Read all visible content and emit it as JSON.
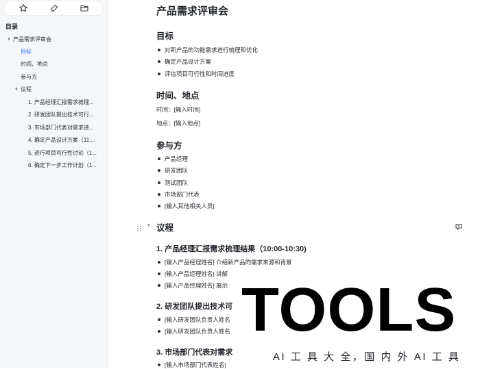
{
  "sidebar": {
    "toolbar": {
      "icons": [
        "star-icon",
        "tag-icon",
        "folder-icon"
      ]
    },
    "toc_title": "目录",
    "items": [
      {
        "label": "产品需求评审会",
        "level": 0,
        "caret": "▼"
      },
      {
        "label": "目标",
        "level": 1,
        "active": true
      },
      {
        "label": "时间、地点",
        "level": 1
      },
      {
        "label": "参与方",
        "level": 1
      },
      {
        "label": "议程",
        "level": 1,
        "caret": "▼"
      },
      {
        "label": "1. 产品经理汇报需求梳理...",
        "level": 2
      },
      {
        "label": "2. 研发团队提出技术可行...",
        "level": 2
      },
      {
        "label": "3. 市场部门代表对需求进...",
        "level": 2
      },
      {
        "label": "4. 确定产品设计方案（11:...",
        "level": 2
      },
      {
        "label": "5. 进行项目可行性讨论（1...",
        "level": 2
      },
      {
        "label": "6. 确定下一步工作计划（1...",
        "level": 2
      }
    ]
  },
  "doc": {
    "title": "产品需求评审会",
    "goal": {
      "heading": "目标",
      "items": [
        "对新产品的功能需求进行梳理和优化",
        "确定产品设计方案",
        "评估项目可行性和时间进度"
      ]
    },
    "time_place": {
      "heading": "时间、地点",
      "time": "时间：[输入时间]",
      "place": "地点：[输入地点]"
    },
    "participants": {
      "heading": "参与方",
      "items": [
        "产品经理",
        "研发团队",
        "测试团队",
        "市场部门代表",
        "[输入其他相关人员]"
      ]
    },
    "agenda": {
      "heading": "议程",
      "sections": [
        {
          "heading": "1. 产品经理汇报需求梳理结果（10:00-10:30)",
          "items": [
            "[输入产品经理姓名] 介绍新产品的需求来源和背景",
            "[输入产品经理姓名] 讲解",
            "[输入产品经理姓名] 展示"
          ]
        },
        {
          "heading": "2. 研发团队提出技术可",
          "items": [
            "[输入研发团队负责人姓名",
            "[输入研发团队负责人姓名"
          ]
        },
        {
          "heading": "3. 市场部门代表对需求",
          "items": [
            "[输入市场部门代表姓名]"
          ]
        }
      ]
    }
  },
  "watermark": {
    "big": "TOOLS",
    "sub": "AI 工 具 大 全，国 内 外 AI 工 具"
  },
  "colors": {
    "accent": "#3370ff",
    "sidebar_bg": "#f5f6f8",
    "text": "#1f2329"
  }
}
